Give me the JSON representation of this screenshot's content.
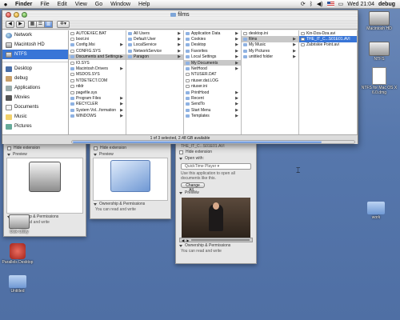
{
  "menubar": {
    "apple": "",
    "menus": [
      "Finder",
      "File",
      "Edit",
      "View",
      "Go",
      "Window",
      "Help"
    ],
    "clock": "Wed 21:04",
    "user": "debug"
  },
  "finder": {
    "title": "films",
    "toolbar": {
      "back": "◀",
      "forward": "▶",
      "views": [
        "▦",
        "☰",
        "▥"
      ],
      "action": "✲▾"
    },
    "sidebar": [
      {
        "label": "Network",
        "icon": "globe"
      },
      {
        "label": "Macintosh HD",
        "icon": "disk"
      },
      {
        "label": "NTFS",
        "icon": "disk",
        "selected": true
      },
      {
        "label": "Desktop",
        "icon": "desk"
      },
      {
        "label": "debug",
        "icon": "house"
      },
      {
        "label": "Applications",
        "icon": "apps"
      },
      {
        "label": "Movies",
        "icon": "movie"
      },
      {
        "label": "Documents",
        "icon": "doc"
      },
      {
        "label": "Music",
        "icon": "music"
      },
      {
        "label": "Pictures",
        "icon": "pic"
      }
    ],
    "columns": [
      [
        {
          "name": "AUTOEXEC.BAT",
          "kind": "file"
        },
        {
          "name": "boot.ini",
          "kind": "file"
        },
        {
          "name": "Config.Msi",
          "kind": "folder",
          "arrow": true
        },
        {
          "name": "CONFIG.SYS",
          "kind": "file"
        },
        {
          "name": "Documents and Settings",
          "kind": "folder",
          "arrow": true,
          "path": true
        },
        {
          "name": "IO.SYS",
          "kind": "file"
        },
        {
          "name": "Macintosh Drivers",
          "kind": "folder",
          "arrow": true
        },
        {
          "name": "MSDOS.SYS",
          "kind": "file"
        },
        {
          "name": "NTDETECT.COM",
          "kind": "file"
        },
        {
          "name": "ntldr",
          "kind": "file"
        },
        {
          "name": "pagefile.sys",
          "kind": "file"
        },
        {
          "name": "Program Files",
          "kind": "folder",
          "arrow": true
        },
        {
          "name": "RECYCLER",
          "kind": "folder",
          "arrow": true
        },
        {
          "name": "System Vol...formation",
          "kind": "folder",
          "arrow": true
        },
        {
          "name": "WINDOWS",
          "kind": "folder",
          "arrow": true
        }
      ],
      [
        {
          "name": "All Users",
          "kind": "folder",
          "arrow": true
        },
        {
          "name": "Default User",
          "kind": "folder",
          "arrow": true
        },
        {
          "name": "LocalService",
          "kind": "folder",
          "arrow": true
        },
        {
          "name": "NetworkService",
          "kind": "folder",
          "arrow": true
        },
        {
          "name": "Paragon",
          "kind": "folder",
          "arrow": true,
          "path": true
        }
      ],
      [
        {
          "name": "Application Data",
          "kind": "folder",
          "arrow": true
        },
        {
          "name": "Cookies",
          "kind": "folder",
          "arrow": true
        },
        {
          "name": "Desktop",
          "kind": "folder",
          "arrow": true
        },
        {
          "name": "Favorites",
          "kind": "folder",
          "arrow": true
        },
        {
          "name": "Local Settings",
          "kind": "folder",
          "arrow": true
        },
        {
          "name": "My Documents",
          "kind": "folder",
          "arrow": true,
          "path": true
        },
        {
          "name": "NetHood",
          "kind": "folder",
          "arrow": true
        },
        {
          "name": "NTUSER.DAT",
          "kind": "file"
        },
        {
          "name": "ntuser.dat.LOG",
          "kind": "file"
        },
        {
          "name": "ntuser.ini",
          "kind": "file"
        },
        {
          "name": "PrintHood",
          "kind": "folder",
          "arrow": true
        },
        {
          "name": "Recent",
          "kind": "folder",
          "arrow": true
        },
        {
          "name": "SendTo",
          "kind": "folder",
          "arrow": true
        },
        {
          "name": "Start Menu",
          "kind": "folder",
          "arrow": true
        },
        {
          "name": "Templates",
          "kind": "folder",
          "arrow": true
        }
      ],
      [
        {
          "name": "desktop.ini",
          "kind": "file"
        },
        {
          "name": "films",
          "kind": "folder",
          "arrow": true,
          "path": true
        },
        {
          "name": "My Music",
          "kind": "folder",
          "arrow": true
        },
        {
          "name": "My Pictures",
          "kind": "folder",
          "arrow": true
        },
        {
          "name": "untitled folder",
          "kind": "folder",
          "arrow": true
        }
      ],
      [
        {
          "name": "Kin-Dza-Dza.avi",
          "kind": "file"
        },
        {
          "name": "THE_IT_C...S01E01.AVI",
          "kind": "file",
          "selected": true
        },
        {
          "name": "Zabriskie Point.avi",
          "kind": "file"
        }
      ]
    ],
    "status": "1 of 3 selected, 2.48 GB available",
    "scroll_fraction": 0.88
  },
  "info_panels": {
    "hd": {
      "hide_ext": "Hide extension",
      "preview": "Preview",
      "owner": "Ownership & Permissions",
      "perm": "You can read and write"
    },
    "folder": {
      "hide_ext": "Hide extension",
      "preview": "Preview",
      "owner": "Ownership & Permissions",
      "perm": "You can read and write"
    },
    "movie": {
      "filename": "THE_IT_C...S01E01.AVI",
      "hide_ext": "Hide extension",
      "open_with": "Open with:",
      "app": "QuickTime Player",
      "desc": "Use this application to open all documents like this.",
      "change_all": "Change All...",
      "preview": "Preview",
      "owner": "Ownership & Permissions",
      "perm": "You can read and write"
    }
  },
  "desktop_icons": [
    {
      "label": "Macintosh HD",
      "art": "hd"
    },
    {
      "label": "NTFS",
      "art": "hd"
    },
    {
      "label": "NTFS for Mac OS X 6.0.dmg",
      "art": "doc"
    },
    {
      "label": "work",
      "art": "folder"
    },
    {
      "label": "Disk Utility",
      "art": "hd"
    },
    {
      "label": "Parallels Desktop",
      "art": "app"
    },
    {
      "label": "Untitled",
      "art": "folder"
    }
  ]
}
